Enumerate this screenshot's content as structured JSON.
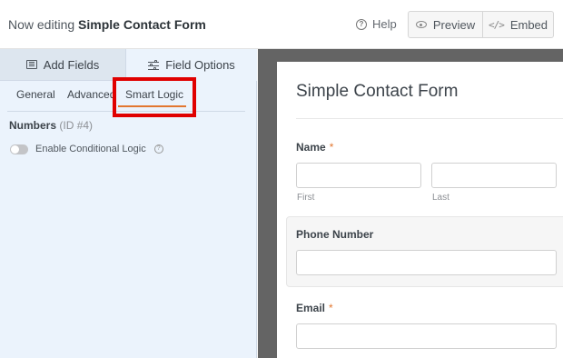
{
  "header": {
    "editing_prefix": "Now editing",
    "form_name": "Simple Contact Form",
    "help_label": "Help",
    "preview_label": "Preview",
    "embed_label": "Embed"
  },
  "sidebar": {
    "tabs": [
      {
        "label": "Add Fields",
        "icon": "list-icon",
        "active": false
      },
      {
        "label": "Field Options",
        "icon": "sliders-icon",
        "active": true
      }
    ],
    "sub_tabs": [
      {
        "label": "General",
        "active": false
      },
      {
        "label": "Advanced",
        "active": false
      },
      {
        "label": "Smart Logic",
        "active": true,
        "highlighted": true
      }
    ],
    "field": {
      "name": "Numbers",
      "id_text": "(ID #4)"
    },
    "conditional_logic": {
      "label": "Enable Conditional Logic",
      "enabled": false
    }
  },
  "form_preview": {
    "title": "Simple Contact Form",
    "fields": {
      "name": {
        "label": "Name",
        "required_mark": "*",
        "first_sublabel": "First",
        "last_sublabel": "Last"
      },
      "phone": {
        "label": "Phone Number"
      },
      "email": {
        "label": "Email",
        "required_mark": "*"
      }
    }
  },
  "colors": {
    "accent": "#e27730",
    "highlight_box": "#e00000",
    "sidebar_bg": "#ebf3fc",
    "preview_bg": "#646464"
  }
}
